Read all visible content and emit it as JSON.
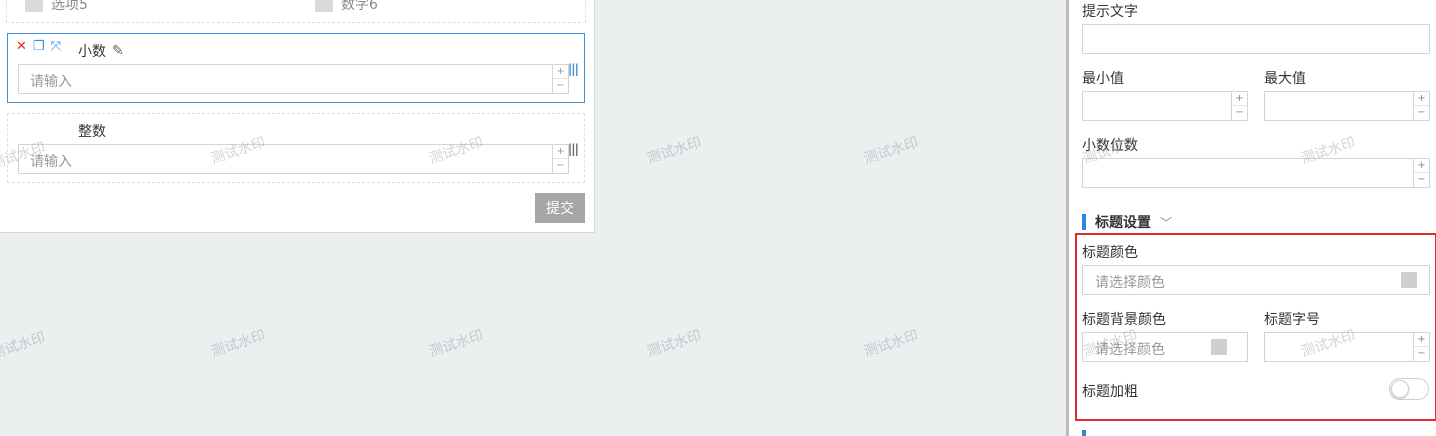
{
  "form": {
    "top_options": [
      "选项5",
      "数字6"
    ],
    "decimal_field": {
      "label": "小数",
      "placeholder": "请输入"
    },
    "integer_field": {
      "label": "整数",
      "placeholder": "请输入"
    },
    "spin_up": "+",
    "spin_down": "−",
    "submit_label": "提交"
  },
  "panel": {
    "hint_label": "提示文字",
    "min_label": "最小值",
    "max_label": "最大值",
    "decimal_places_label": "小数位数",
    "title_section": "标题设置",
    "title_color_label": "标题颜色",
    "title_color_placeholder": "请选择颜色",
    "title_bg_color_label": "标题背景颜色",
    "title_bg_color_placeholder": "请选择颜色",
    "title_font_size_label": "标题字号",
    "title_bold_label": "标题加粗",
    "title_bold_on": false
  },
  "watermark": "测试水印",
  "colors": {
    "accent": "#3a8fd6",
    "highlight": "#e0282d",
    "section_bar": "#2e86de",
    "delete": "#e02b2b"
  }
}
